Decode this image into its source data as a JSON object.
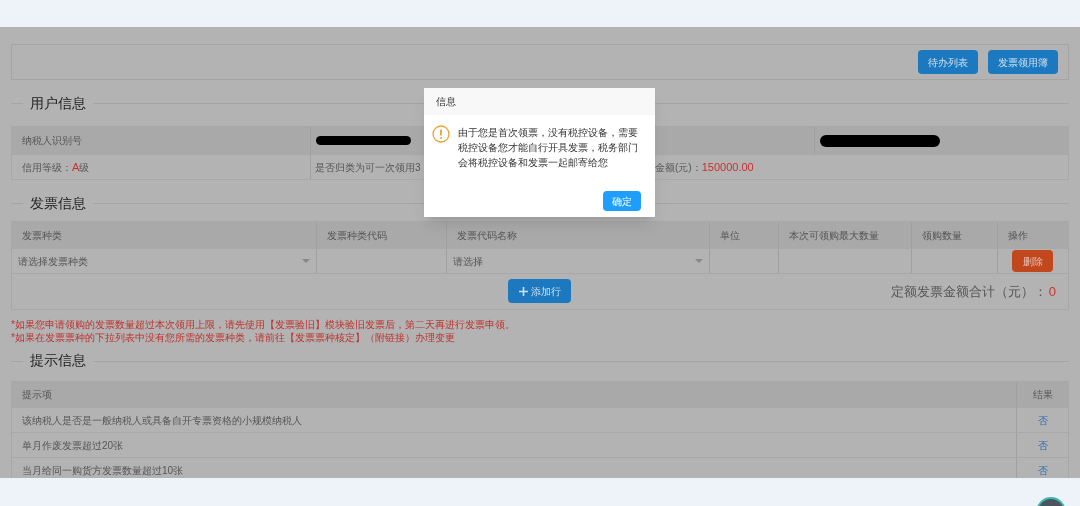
{
  "toolbar": {
    "buttons": [
      "待办列表",
      "发票领用簿"
    ]
  },
  "user_info": {
    "title": "用户信息",
    "taxpayer_id_label": "纳税人识别号",
    "credit_label": "信用等级：",
    "credit_value": "A",
    "credit_suffix": "级",
    "category_text": "是否归类为可一次领用3",
    "amount_label": "金额(元)：",
    "amount_value": "150000.00"
  },
  "invoice_info": {
    "title": "发票信息",
    "columns": [
      "发票种类",
      "发票种类代码",
      "发票代码名称",
      "单位",
      "本次可领购最大数量",
      "领购数量",
      "操作"
    ],
    "row": {
      "type_placeholder": "请选择发票种类",
      "name_placeholder": "请选择",
      "delete": "删除"
    },
    "add_row": "添加行",
    "total_label": "定额发票金额合计（元）：",
    "total_value": "0",
    "notes": [
      "*如果您申请领购的发票数量超过本次领用上限，请先使用【发票验旧】模块验旧发票后，第二天再进行发票申领。",
      "*如果在发票票种的下拉列表中没有您所需的发票种类，请前往【发票票种核定】（附链接）办理变更"
    ]
  },
  "tips": {
    "title": "提示信息",
    "columns": [
      "提示项",
      "结果"
    ],
    "rows": [
      {
        "item": "该纳税人是否是一般纳税人或具备自开专票资格的小规模纳税人",
        "result": "否"
      },
      {
        "item": "单月作废发票超过20张",
        "result": "否"
      },
      {
        "item": "当月给同一购货方发票数量超过10张",
        "result": "否"
      }
    ]
  },
  "dialog": {
    "title": "信息",
    "message": "由于您是首次领票，没有税控设备，需要税控设备您才能自行开具发票，税务部门会将税控设备和发票一起邮寄给您",
    "ok": "确定"
  }
}
